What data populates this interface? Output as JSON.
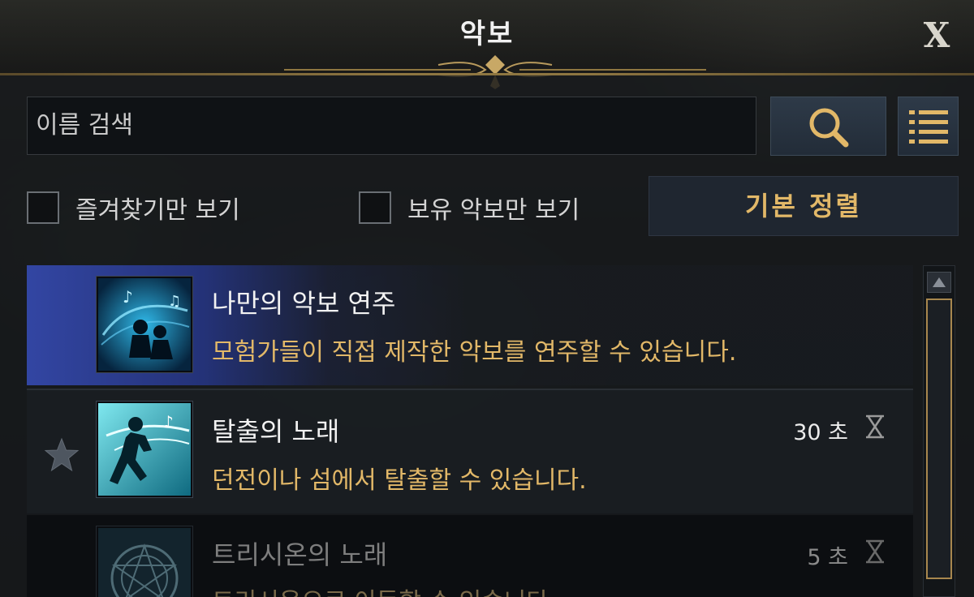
{
  "window": {
    "title": "악보",
    "close_label": "X"
  },
  "search": {
    "placeholder": "이름 검색"
  },
  "filters": {
    "favorites_only": "즐겨찾기만 보기",
    "owned_only": "보유 악보만 보기",
    "sort_label": "기본 정렬"
  },
  "songs": [
    {
      "name": "나만의 악보 연주",
      "description": "모험가들이 직접 제작한 악보를 연주할 수 있습니다.",
      "duration": "",
      "selected": true,
      "icon": "performance-musicians-icon"
    },
    {
      "name": "탈출의 노래",
      "description": "던전이나 섬에서 탈출할 수 있습니다.",
      "duration": "30 초",
      "selected": false,
      "icon": "running-escape-icon"
    },
    {
      "name": "트리시온의 노래",
      "description": "트리시온으로 이동할 수 있습니다.",
      "duration": "5 초",
      "selected": false,
      "icon": "magic-circle-icon"
    }
  ],
  "colors": {
    "accent_gold": "#e2b868",
    "selected_row": "#3448aa",
    "text_primary": "#f2f2f2"
  }
}
